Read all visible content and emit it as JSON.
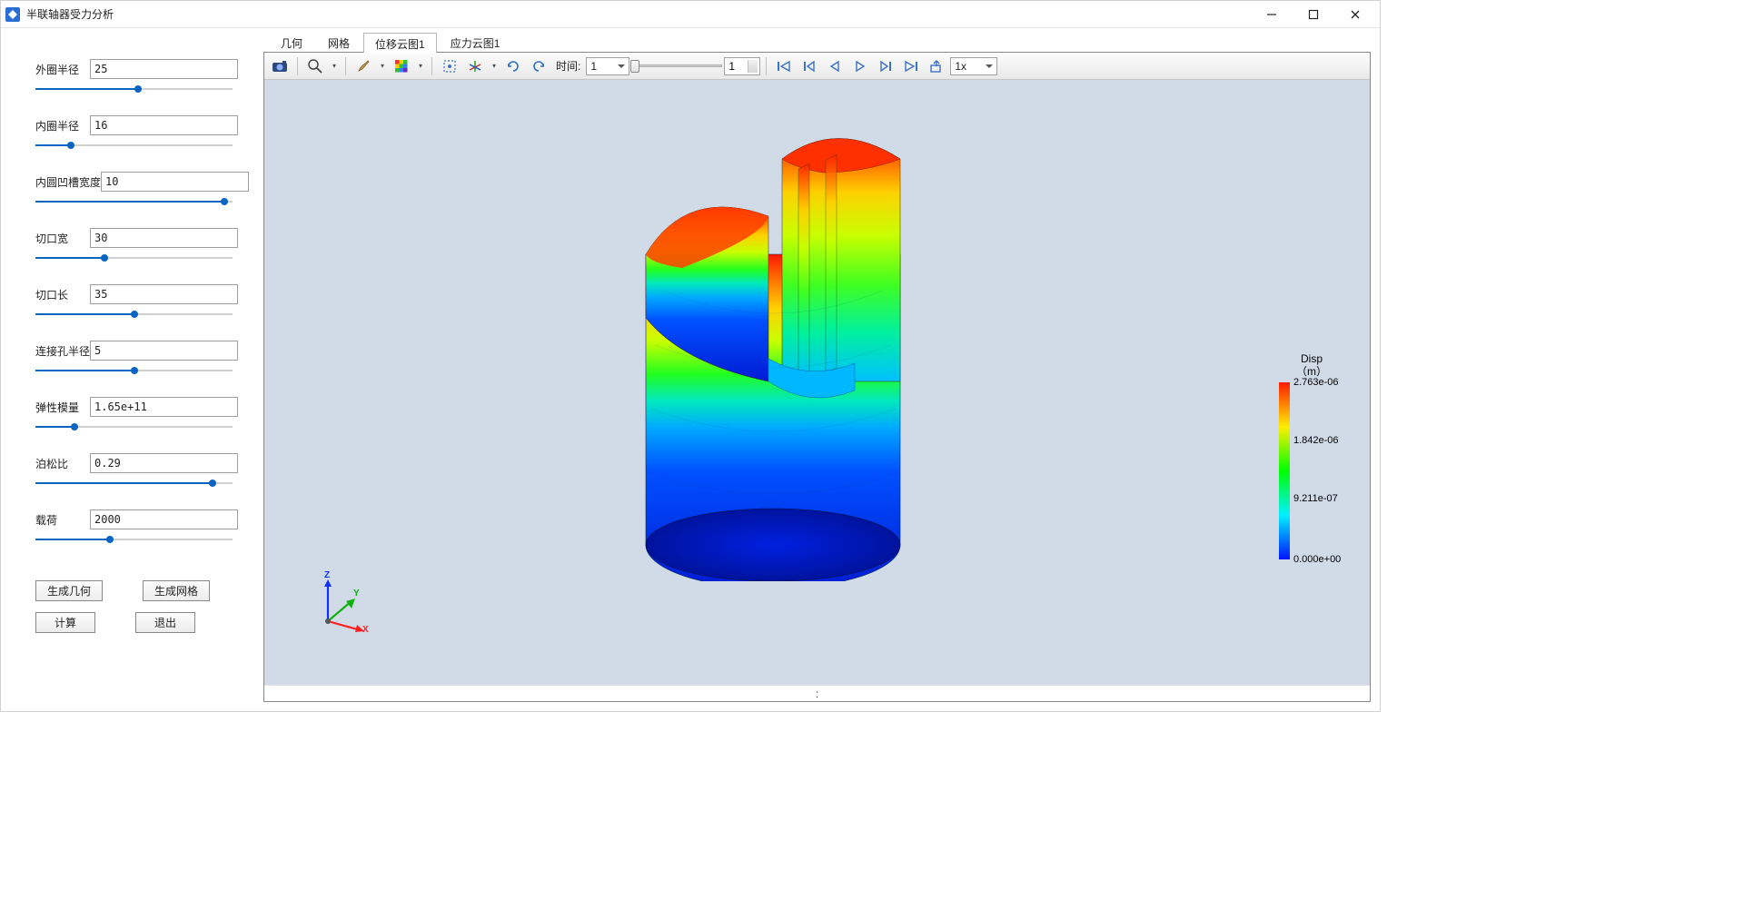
{
  "window": {
    "title": "半联轴器受力分析"
  },
  "params": [
    {
      "label": "外圈半径",
      "value": "25",
      "pos": 52
    },
    {
      "label": "内圈半径",
      "value": "16",
      "pos": 18
    },
    {
      "label": "内圆凹槽宽度",
      "value": "10",
      "pos": 96
    },
    {
      "label": "切口宽",
      "value": "30",
      "pos": 35
    },
    {
      "label": "切口长",
      "value": "35",
      "pos": 50
    },
    {
      "label": "连接孔半径",
      "value": "5",
      "pos": 50
    },
    {
      "label": "弹性模量",
      "value": "1.65e+11",
      "pos": 20
    },
    {
      "label": "泊松比",
      "value": "0.29",
      "pos": 90
    },
    {
      "label": "载荷",
      "value": "2000",
      "pos": 38
    }
  ],
  "buttons": {
    "gen_geom": "生成几何",
    "gen_mesh": "生成网格",
    "compute": "计算",
    "exit": "退出"
  },
  "tabs": [
    {
      "label": "几何",
      "active": false
    },
    {
      "label": "网格",
      "active": false
    },
    {
      "label": "位移云图1",
      "active": true
    },
    {
      "label": "应力云图1",
      "active": false
    }
  ],
  "toolbar": {
    "time_label": "时间:",
    "time_select": "1",
    "time_spin": "1",
    "speed_select": "1x"
  },
  "legend": {
    "title": "Disp",
    "unit": "（m）",
    "ticks": [
      {
        "value": "2.763e-06",
        "pos": 0
      },
      {
        "value": "1.842e-06",
        "pos": 33
      },
      {
        "value": "9.211e-07",
        "pos": 66
      },
      {
        "value": "0.000e+00",
        "pos": 100
      }
    ]
  },
  "triad": {
    "x": "X",
    "y": "Y",
    "z": "Z"
  },
  "footer": ":"
}
